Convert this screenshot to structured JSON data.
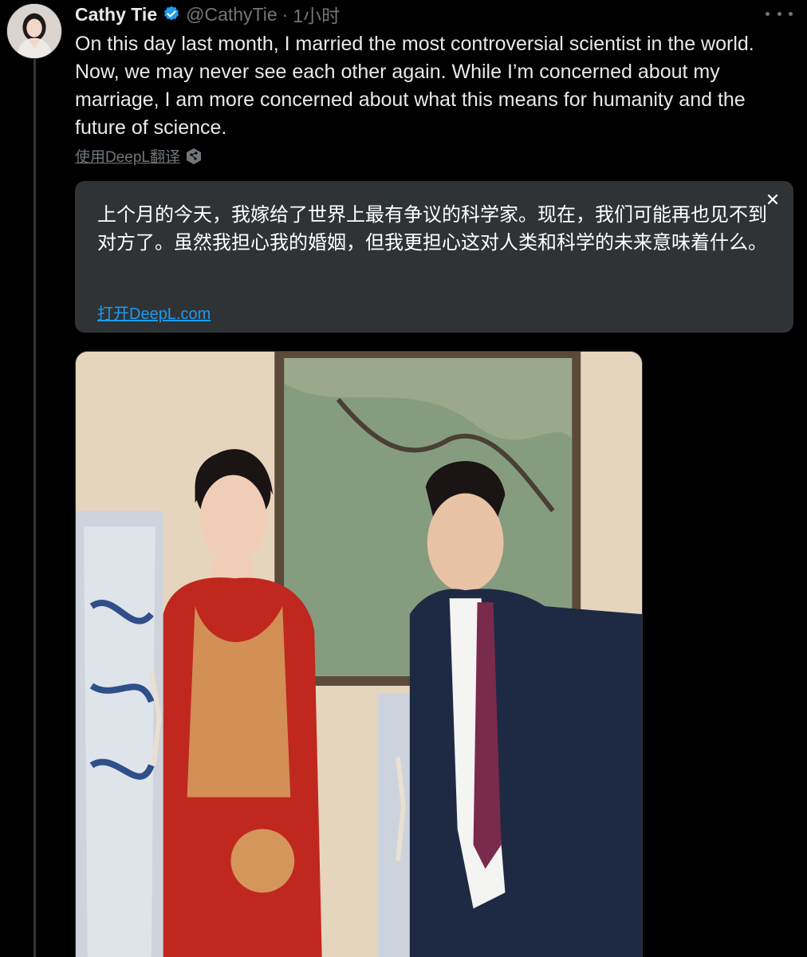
{
  "author": {
    "name": "Cathy Tie",
    "handle": "@CathyTie",
    "separator": "·",
    "time": "1小时",
    "verified": true,
    "avatar_icon": "profile-photo"
  },
  "tweet": {
    "text": "On this day last month, I married the most controversial scientist in the world. Now, we may never see each other again. While I’m concerned about my marriage, I am more concerned about what this means for humanity and the future of science."
  },
  "translate": {
    "link_label": "使用DeepL翻译",
    "icon": "deepl-icon",
    "translation": "上个月的今天，我嫁给了世界上最有争议的科学家。现在，我们可能再也见不到对方了。虽然我担心我的婚姻，但我更担心这对人类和科学的未来意味着什么。",
    "open_label": "打开DeepL.com",
    "close_icon": "close-icon"
  },
  "media": {
    "type": "photo",
    "icon": "wedding-photo"
  },
  "colors": {
    "background": "#000000",
    "text": "#e7e9ea",
    "secondary": "#71767b",
    "link": "#1d9bf0",
    "verified": "#1d9bf0",
    "translation_bg": "#2f3336"
  }
}
